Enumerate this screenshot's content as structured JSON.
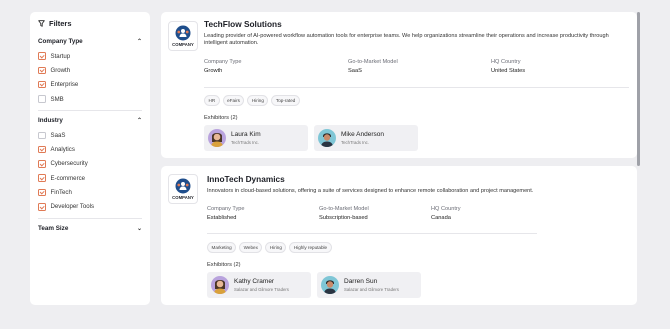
{
  "filters": {
    "title": "Filters",
    "sections": [
      {
        "title": "Company Type",
        "options": [
          {
            "label": "Startup",
            "checked": true
          },
          {
            "label": "Growth",
            "checked": true
          },
          {
            "label": "Enterprise",
            "checked": true
          },
          {
            "label": "SMB",
            "checked": false
          }
        ]
      },
      {
        "title": "Industry",
        "options": [
          {
            "label": "SaaS",
            "checked": false
          },
          {
            "label": "Analytics",
            "checked": true
          },
          {
            "label": "Cybersecurity",
            "checked": true
          },
          {
            "label": "E-commerce",
            "checked": true
          },
          {
            "label": "FinTech",
            "checked": true
          },
          {
            "label": "Developer Tools",
            "checked": true
          }
        ]
      },
      {
        "title": "Team Size"
      }
    ]
  },
  "companies": [
    {
      "logo_text": "COMPANY",
      "name": "TechFlow Solutions",
      "description": "Leading provider of AI-powered workflow automation tools for enterprise teams. We help organizations streamline their operations and increase productivity through intelligent automation.",
      "meta": [
        {
          "label": "Company Type",
          "value": "Growth"
        },
        {
          "label": "Go-to-Market Model",
          "value": "SaaS"
        },
        {
          "label": "HQ Country",
          "value": "United States"
        }
      ],
      "tags": [
        "HR",
        "eFairs",
        "Hiring",
        "Top-rated"
      ],
      "exhibitors_label": "Exhibitors (2)",
      "exhibitors": [
        {
          "name": "Laura Kim",
          "company": "TechTrads Inc.",
          "avatar_bg": "#b9a3dd"
        },
        {
          "name": "Mike Anderson",
          "company": "TechTrads Inc.",
          "avatar_bg": "#7fc6d6"
        }
      ]
    },
    {
      "logo_text": "COMPANY",
      "name": "InnoTech Dynamics",
      "description": "Innovators in cloud-based solutions, offering a suite of services designed to enhance remote collaboration and project management.",
      "meta": [
        {
          "label": "Company Type",
          "value": "Established"
        },
        {
          "label": "Go-to-Market Model",
          "value": "Subscription-based"
        },
        {
          "label": "HQ Country",
          "value": "Canada"
        }
      ],
      "tags": [
        "Marketing",
        "Webex",
        "Hiring",
        "Highly reputable"
      ],
      "exhibitors_label": "Exhibitors (2)",
      "exhibitors": [
        {
          "name": "Kathy Cramer",
          "company": "Salazar and Gilmore Traders",
          "avatar_bg": "#b9a3dd"
        },
        {
          "name": "Darren Sun",
          "company": "Salazar and Gilmore Traders",
          "avatar_bg": "#7fc6d6"
        }
      ]
    }
  ],
  "colors": {
    "accent": "#e07a55",
    "logo_blue": "#1f4e8c"
  }
}
